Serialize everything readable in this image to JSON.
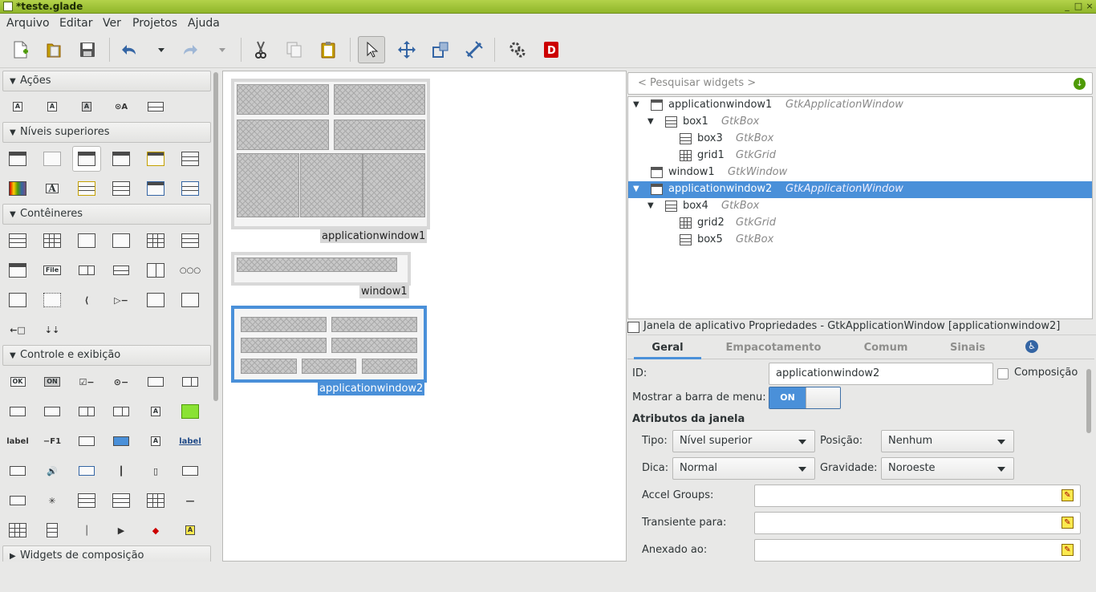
{
  "window": {
    "title": "*teste.glade"
  },
  "menubar": {
    "items": [
      "Arquivo",
      "Editar",
      "Ver",
      "Projetos",
      "Ajuda"
    ]
  },
  "toolbar": {
    "items": [
      "new-file-icon",
      "open-file-icon",
      "save-icon",
      "undo-icon",
      "undo-menu-icon",
      "redo-icon",
      "redo-menu-icon",
      "cut-icon",
      "copy-icon",
      "paste-icon",
      "pointer-icon",
      "drag-resize-icon",
      "margin-edit-icon",
      "align-edit-icon",
      "preferences-icon",
      "devhelp-icon"
    ]
  },
  "palette": {
    "categories": [
      {
        "label": "Ações",
        "expanded": true
      },
      {
        "label": "Níveis superiores",
        "expanded": true
      },
      {
        "label": "Contêineres",
        "expanded": true
      },
      {
        "label": "Controle e exibição",
        "expanded": true
      },
      {
        "label": "Widgets de composição",
        "expanded": false
      }
    ],
    "glyph_texts": {
      "ok": "OK",
      "on": "ON",
      "file": "File",
      "label": "label",
      "f1": "−F1",
      "a": "A"
    }
  },
  "canvas": {
    "previews": [
      {
        "name": "applicationwindow1",
        "selected": false
      },
      {
        "name": "window1",
        "selected": false
      },
      {
        "name": "applicationwindow2",
        "selected": true
      }
    ]
  },
  "inspector": {
    "search_placeholder": "< Pesquisar widgets >",
    "tree": [
      {
        "name": "applicationwindow1",
        "type": "GtkApplicationWindow",
        "level": 0,
        "expander": "down",
        "icon": "window-icon",
        "selected": false
      },
      {
        "name": "box1",
        "type": "GtkBox",
        "level": 1,
        "expander": "down",
        "icon": "box-icon",
        "selected": false
      },
      {
        "name": "box3",
        "type": "GtkBox",
        "level": 2,
        "expander": "",
        "icon": "box-icon",
        "selected": false
      },
      {
        "name": "grid1",
        "type": "GtkGrid",
        "level": 2,
        "expander": "",
        "icon": "grid-icon",
        "selected": false
      },
      {
        "name": "window1",
        "type": "GtkWindow",
        "level": 0,
        "expander": "",
        "icon": "window-icon",
        "selected": false
      },
      {
        "name": "applicationwindow2",
        "type": "GtkApplicationWindow",
        "level": 0,
        "expander": "down",
        "icon": "window-icon",
        "selected": true
      },
      {
        "name": "box4",
        "type": "GtkBox",
        "level": 1,
        "expander": "down",
        "icon": "box-icon",
        "selected": false
      },
      {
        "name": "grid2",
        "type": "GtkGrid",
        "level": 2,
        "expander": "",
        "icon": "grid-icon",
        "selected": false
      },
      {
        "name": "box5",
        "type": "GtkBox",
        "level": 2,
        "expander": "",
        "icon": "box-icon",
        "selected": false
      }
    ]
  },
  "properties": {
    "header": "Janela de aplicativo Propriedades - GtkApplicationWindow [applicationwindow2]",
    "tabs": [
      "Geral",
      "Empacotamento",
      "Comum",
      "Sinais"
    ],
    "active_tab": "Geral",
    "id_label": "ID:",
    "id_value": "applicationwindow2",
    "composite_label": "Composição",
    "composite_checked": false,
    "menubar_label": "Mostrar a barra de menu:",
    "menubar_switch": "ON",
    "section_title": "Atributos da janela",
    "type_label": "Tipo:",
    "type_value": "Nível superior",
    "position_label": "Posição:",
    "position_value": "Nenhum",
    "hint_label": "Dica:",
    "hint_value": "Normal",
    "gravity_label": "Gravidade:",
    "gravity_value": "Noroeste",
    "accel_label": "Accel Groups:",
    "accel_value": "",
    "transient_label": "Transiente para:",
    "transient_value": "",
    "attached_label": "Anexado ao:",
    "attached_value": ""
  },
  "colors": {
    "titlebar": "#a4c639",
    "selection": "#4a90d9",
    "accent": "#4a90d9"
  }
}
